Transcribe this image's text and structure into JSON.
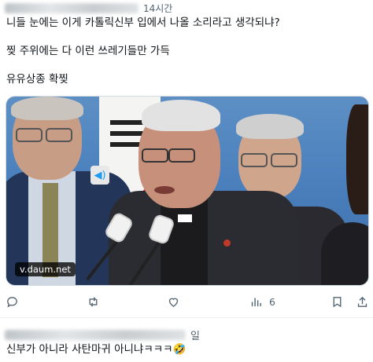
{
  "post": {
    "time": "14시간",
    "lines": [
      "니들 눈에는 이게 카톨릭신부 입에서 나올 소리라고 생각되냐?",
      "찢 주위에는 다 이런 쓰레기들만 가득",
      "유유상종 확찢"
    ],
    "media": {
      "source": "v.daum.net",
      "speaker_icon": "speaker-icon"
    },
    "actions": {
      "reply_count": "",
      "repost_count": "",
      "like_count": "",
      "views_count": "6"
    }
  },
  "reply": {
    "time": "일",
    "text": "신부가 아니라 사탄마귀 아니냐ㅋㅋㅋ🤣"
  }
}
